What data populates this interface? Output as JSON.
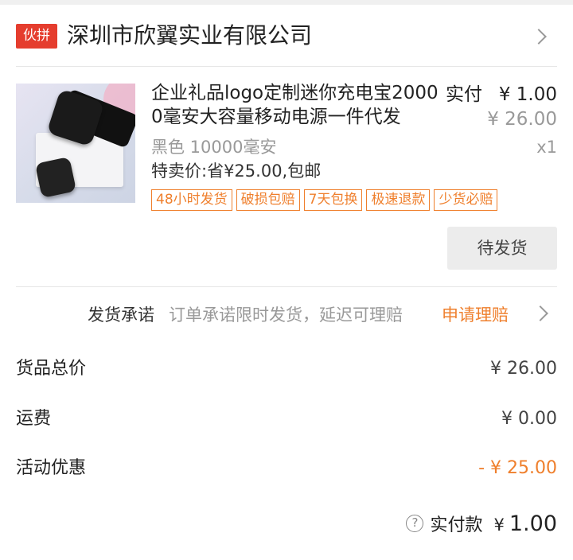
{
  "store": {
    "badge": "伙拼",
    "name": "深圳市欣翼实业有限公司"
  },
  "product": {
    "title": "企业礼品logo定制迷你充电宝20000毫安大容量移动电源一件代发",
    "pay_label": "实付",
    "pay_price": "¥ 1.00",
    "original_price": "¥ 26.00",
    "spec": "黑色 10000毫安",
    "quantity": "x1",
    "special_price": "特卖价:省¥25.00,包邮",
    "tags": [
      "48小时发货",
      "破损包赔",
      "7天包换",
      "极速退款",
      "少货必赔"
    ],
    "status": "待发货"
  },
  "promise": {
    "title": "发货承诺",
    "desc": "订单承诺限时发货，延迟可理赔",
    "link": "申请理赔"
  },
  "summary": {
    "goods_total_label": "货品总价",
    "goods_total_value": "¥ 26.00",
    "shipping_label": "运费",
    "shipping_value": "¥ 0.00",
    "discount_label": "活动优惠",
    "discount_value": "- ¥ 25.00"
  },
  "total": {
    "label": "实付款",
    "currency": "¥",
    "value": "1.00",
    "help_glyph": "?"
  }
}
